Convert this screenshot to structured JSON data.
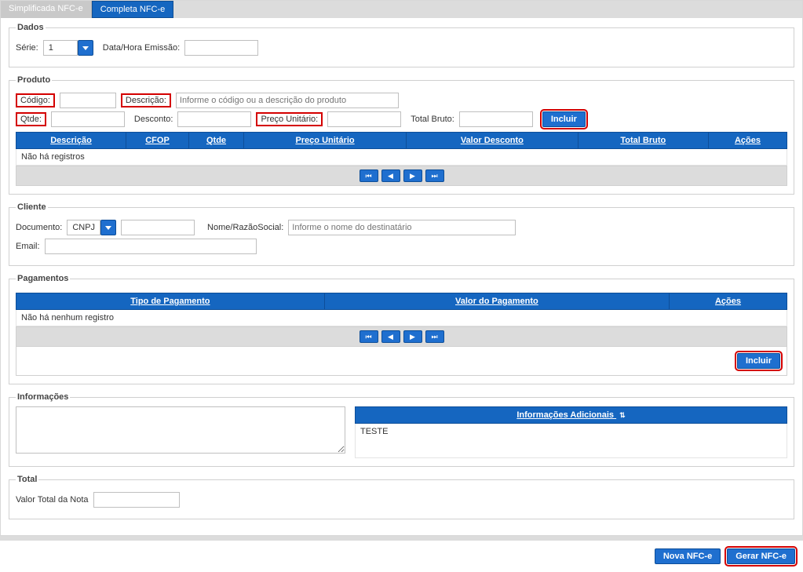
{
  "tabs": {
    "simplificada": "Simplificada NFC-e",
    "completa": "Completa NFC-e"
  },
  "dados": {
    "legend": "Dados",
    "serieLabel": "Série:",
    "serieValue": "1",
    "dataHoraLabel": "Data/Hora Emissão:"
  },
  "produto": {
    "legend": "Produto",
    "codigoLabel": "Código:",
    "descricaoLabel": "Descrição:",
    "descricaoPlaceholder": "Informe o código ou a descrição do produto",
    "qtdeLabel": "Qtde:",
    "descontoLabel": "Desconto:",
    "precoLabel": "Preço Unitário:",
    "totalBrutoLabel": "Total Bruto:",
    "incluir": "Incluir",
    "cols": {
      "descricao": "Descrição",
      "cfop": "CFOP",
      "qtde": "Qtde",
      "preco": "Preço Unitário",
      "desconto": "Valor Desconto",
      "total": "Total Bruto",
      "acoes": "Ações"
    },
    "empty": "Não há registros"
  },
  "cliente": {
    "legend": "Cliente",
    "documentoLabel": "Documento:",
    "documentoValue": "CNPJ",
    "razaoLabel": "Nome/RazãoSocial:",
    "razaoPlaceholder": "Informe o nome do destinatário",
    "emailLabel": "Email:"
  },
  "pagamentos": {
    "legend": "Pagamentos",
    "cols": {
      "tipo": "Tipo de Pagamento",
      "valor": "Valor do Pagamento",
      "acoes": "Ações"
    },
    "empty": "Não há nenhum registro",
    "incluir": "Incluir"
  },
  "informacoes": {
    "legend": "Informações",
    "header": "Informações Adicionais",
    "body": "TESTE"
  },
  "total": {
    "legend": "Total",
    "valorLabel": "Valor Total da Nota"
  },
  "footer": {
    "nova": "Nova NFC-e",
    "gerar": "Gerar NFC-e"
  },
  "pager": {
    "first": "⏮",
    "prev": "◀",
    "next": "▶",
    "last": "⏭"
  }
}
